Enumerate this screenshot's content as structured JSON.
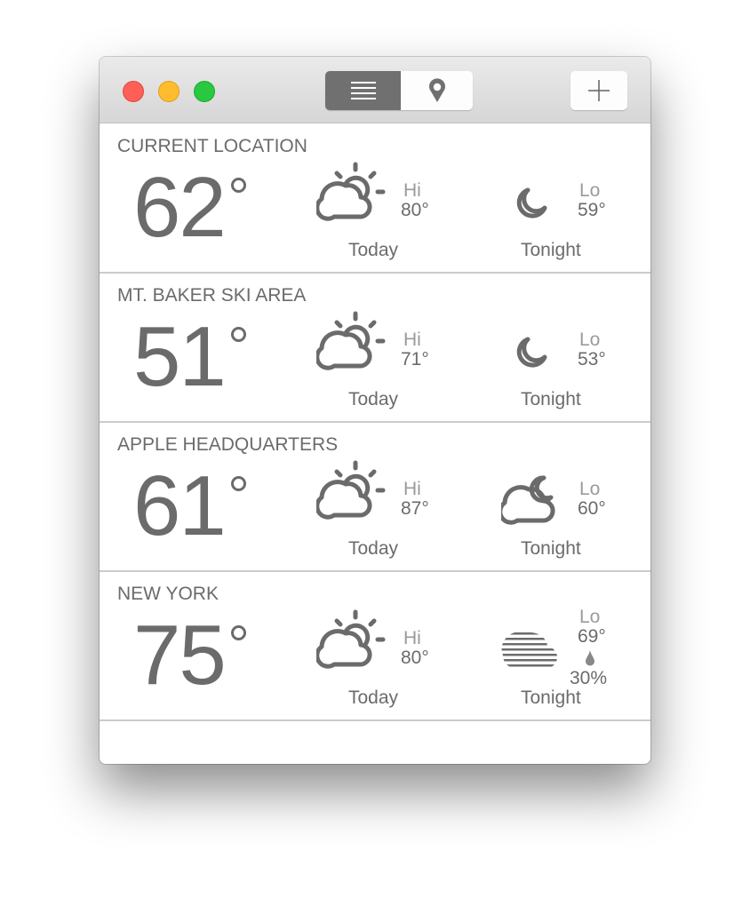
{
  "window": {
    "traffic_lights": [
      "close",
      "minimize",
      "zoom"
    ],
    "colors": {
      "close": "#fe5f57",
      "minimize": "#febc2e",
      "zoom": "#28c840",
      "text": "#6b6b6b",
      "muted_text": "#9a9a9a",
      "segment_active": "#707070"
    }
  },
  "toolbar": {
    "view_segments": [
      {
        "name": "list-view",
        "icon": "list-icon",
        "selected": true
      },
      {
        "name": "map-view",
        "icon": "map-pin-icon",
        "selected": false
      }
    ],
    "add_button_icon": "plus-icon"
  },
  "locations": [
    {
      "name": "CURRENT LOCATION",
      "temp": "62",
      "today": {
        "icon": "partly-cloudy-day-icon",
        "hi_label": "Hi",
        "hi": "80°",
        "label": "Today"
      },
      "tonight": {
        "icon": "moon-icon",
        "lo_label": "Lo",
        "lo": "59°",
        "label": "Tonight"
      }
    },
    {
      "name": "MT. BAKER SKI AREA",
      "temp": "51",
      "today": {
        "icon": "partly-cloudy-day-icon",
        "hi_label": "Hi",
        "hi": "71°",
        "label": "Today"
      },
      "tonight": {
        "icon": "moon-icon",
        "lo_label": "Lo",
        "lo": "53°",
        "label": "Tonight"
      }
    },
    {
      "name": "APPLE HEADQUARTERS",
      "temp": "61",
      "today": {
        "icon": "partly-cloudy-day-icon",
        "hi_label": "Hi",
        "hi": "87°",
        "label": "Today"
      },
      "tonight": {
        "icon": "partly-cloudy-night-icon",
        "lo_label": "Lo",
        "lo": "60°",
        "label": "Tonight"
      }
    },
    {
      "name": "NEW YORK",
      "temp": "75",
      "today": {
        "icon": "partly-cloudy-day-icon",
        "hi_label": "Hi",
        "hi": "80°",
        "label": "Today"
      },
      "tonight": {
        "icon": "fog-icon",
        "lo_label": "Lo",
        "lo": "69°",
        "label": "Tonight",
        "precip_icon": "raindrop-icon",
        "precip": "30%"
      }
    }
  ]
}
